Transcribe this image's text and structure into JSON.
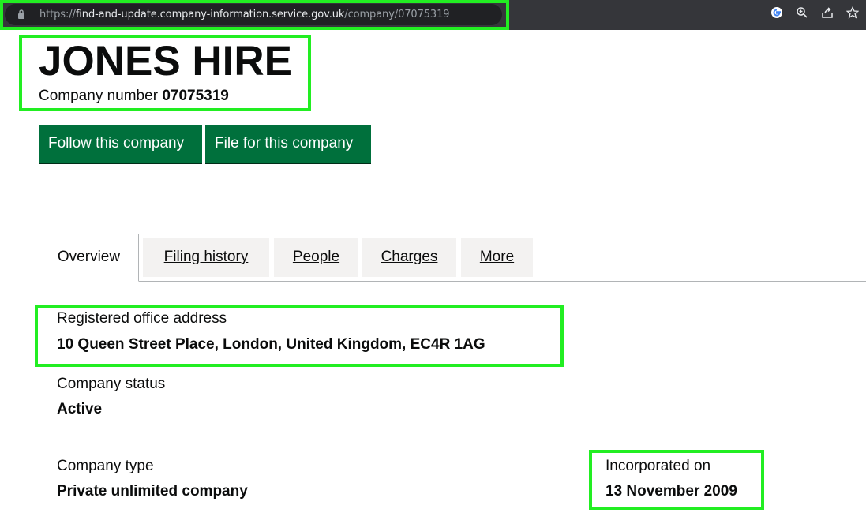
{
  "browser": {
    "url_scheme": "https://",
    "url_host": "find-and-update.company-information.service.gov.uk",
    "url_path": "/company/07075319",
    "icons": [
      "google-icon",
      "zoom-icon",
      "share-icon",
      "bookmark-star-icon"
    ]
  },
  "company": {
    "name": "JONES HIRE",
    "number_label": "Company number",
    "number": "07075319"
  },
  "actions": {
    "follow_label": "Follow this company",
    "file_label": "File for this company"
  },
  "tabs": [
    {
      "label": "Overview",
      "active": true
    },
    {
      "label": "Filing history"
    },
    {
      "label": "People"
    },
    {
      "label": "Charges"
    },
    {
      "label": "More"
    }
  ],
  "overview": {
    "registered_office_label": "Registered office address",
    "registered_office_value": "10 Queen Street Place, London, United Kingdom, EC4R 1AG",
    "status_label": "Company status",
    "status_value": "Active",
    "type_label": "Company type",
    "type_value": "Private unlimited company",
    "incorporated_label": "Incorporated on",
    "incorporated_value": "13 November 2009"
  },
  "colors": {
    "button_green": "#00703c",
    "annotation_green": "#22ee22",
    "tab_bg": "#f3f2f1"
  }
}
